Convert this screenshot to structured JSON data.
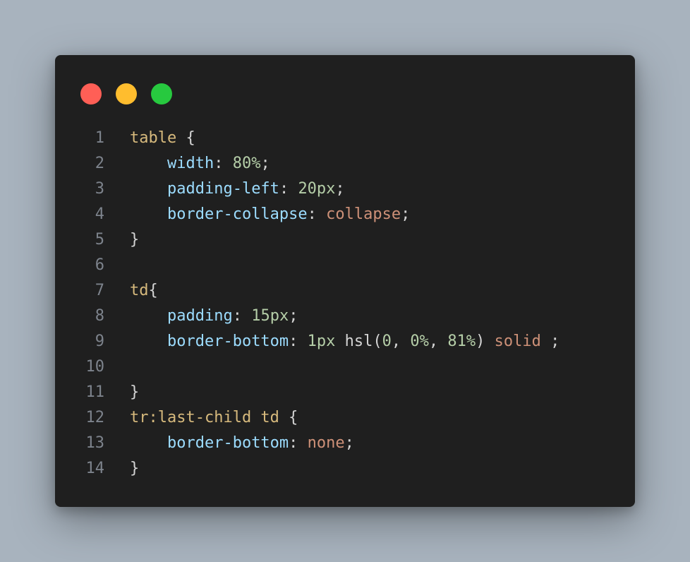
{
  "window_controls": {
    "close_color": "#ff5f56",
    "minimize_color": "#ffbd2e",
    "maximize_color": "#27c93f"
  },
  "code": {
    "lines": [
      {
        "number": "1",
        "tokens": [
          {
            "t": "table",
            "k": "sel"
          },
          {
            "t": " {",
            "k": "punc"
          }
        ]
      },
      {
        "number": "2",
        "tokens": [
          {
            "t": "    ",
            "k": "punc"
          },
          {
            "t": "width",
            "k": "prop"
          },
          {
            "t": ": ",
            "k": "punc"
          },
          {
            "t": "80%",
            "k": "num"
          },
          {
            "t": ";",
            "k": "punc"
          }
        ]
      },
      {
        "number": "3",
        "tokens": [
          {
            "t": "    ",
            "k": "punc"
          },
          {
            "t": "padding-left",
            "k": "prop"
          },
          {
            "t": ": ",
            "k": "punc"
          },
          {
            "t": "20px",
            "k": "num"
          },
          {
            "t": ";",
            "k": "punc"
          }
        ]
      },
      {
        "number": "4",
        "tokens": [
          {
            "t": "    ",
            "k": "punc"
          },
          {
            "t": "border-collapse",
            "k": "prop"
          },
          {
            "t": ": ",
            "k": "punc"
          },
          {
            "t": "collapse",
            "k": "kw"
          },
          {
            "t": ";",
            "k": "punc"
          }
        ]
      },
      {
        "number": "5",
        "tokens": [
          {
            "t": "}",
            "k": "punc"
          }
        ]
      },
      {
        "number": "6",
        "tokens": []
      },
      {
        "number": "7",
        "tokens": [
          {
            "t": "td",
            "k": "sel"
          },
          {
            "t": "{",
            "k": "punc"
          }
        ]
      },
      {
        "number": "8",
        "tokens": [
          {
            "t": "    ",
            "k": "punc"
          },
          {
            "t": "padding",
            "k": "prop"
          },
          {
            "t": ": ",
            "k": "punc"
          },
          {
            "t": "15px",
            "k": "num"
          },
          {
            "t": ";",
            "k": "punc"
          }
        ]
      },
      {
        "number": "9",
        "tokens": [
          {
            "t": "    ",
            "k": "punc"
          },
          {
            "t": "border-bottom",
            "k": "prop"
          },
          {
            "t": ": ",
            "k": "punc"
          },
          {
            "t": "1px",
            "k": "num"
          },
          {
            "t": " hsl(",
            "k": "punc"
          },
          {
            "t": "0",
            "k": "num"
          },
          {
            "t": ", ",
            "k": "punc"
          },
          {
            "t": "0%",
            "k": "num"
          },
          {
            "t": ", ",
            "k": "punc"
          },
          {
            "t": "81%",
            "k": "num"
          },
          {
            "t": ") ",
            "k": "punc"
          },
          {
            "t": "solid",
            "k": "kw"
          },
          {
            "t": " ;",
            "k": "punc"
          }
        ]
      },
      {
        "number": "10",
        "tokens": []
      },
      {
        "number": "11",
        "tokens": [
          {
            "t": "}",
            "k": "punc"
          }
        ]
      },
      {
        "number": "12",
        "tokens": [
          {
            "t": "tr:last-child td",
            "k": "sel"
          },
          {
            "t": " {",
            "k": "punc"
          }
        ]
      },
      {
        "number": "13",
        "tokens": [
          {
            "t": "    ",
            "k": "punc"
          },
          {
            "t": "border-bottom",
            "k": "prop"
          },
          {
            "t": ": ",
            "k": "punc"
          },
          {
            "t": "none",
            "k": "kw"
          },
          {
            "t": ";",
            "k": "punc"
          }
        ]
      },
      {
        "number": "14",
        "tokens": [
          {
            "t": "}",
            "k": "punc"
          }
        ]
      }
    ]
  }
}
